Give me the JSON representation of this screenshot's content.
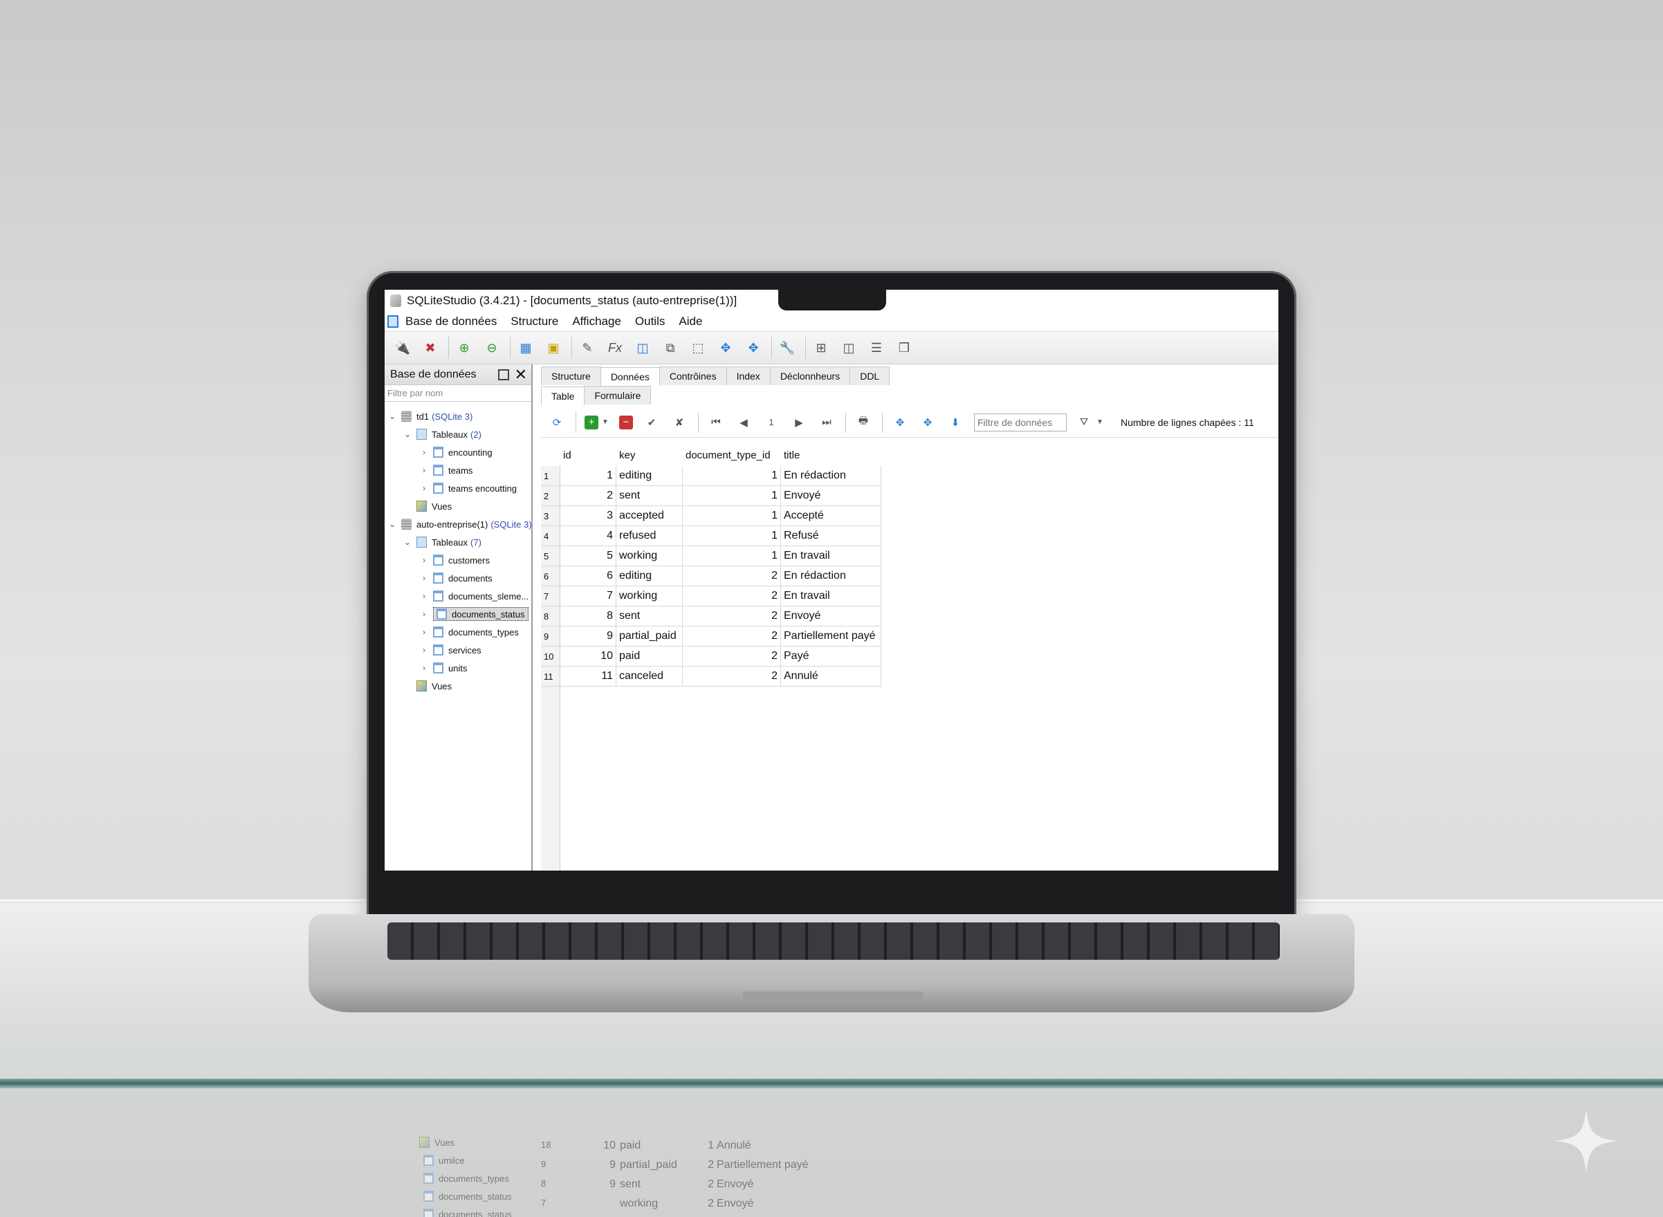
{
  "window": {
    "title": "SQLiteStudio (3.4.21) - [documents_status (auto-entreprise(1))]"
  },
  "menu": [
    "Base de données",
    "Structure",
    "Affichage",
    "Outils",
    "Aide"
  ],
  "left_panel": {
    "header": "Base de données",
    "filter_placeholder": "Filtre par nom",
    "tree": {
      "db1": {
        "name": "td1",
        "type": "(SQLite 3)"
      },
      "db1_tables": {
        "label": "Tableaux",
        "count": "(2)"
      },
      "db1_table_items": [
        "encounting",
        "teams",
        "teams encoutting"
      ],
      "db1_views": "Vues",
      "db2": {
        "name": "auto-entreprise(1)",
        "type": "(SQLite 3)"
      },
      "db2_tables": {
        "label": "Tableaux",
        "count": "(7)"
      },
      "db2_table_items": [
        "customers",
        "documents",
        "documents_sleme...",
        "documents_status",
        "documents_types",
        "services",
        "units"
      ],
      "db2_views": "Vues"
    }
  },
  "tabs": [
    "Structure",
    "Données",
    "Contrôines",
    "Index",
    "Déclonnheurs",
    "DDL"
  ],
  "subtabs": [
    "Table",
    "Formulaire"
  ],
  "data_toolbar": {
    "page": "1",
    "filter_placeholder": "Filtre de données",
    "row_count": "Numbre de lignes chapées : 11"
  },
  "grid": {
    "columns": [
      "id",
      "key",
      "document_type_id",
      "title"
    ],
    "rows": [
      [
        "1",
        "1",
        "editing",
        "1",
        "En rédaction"
      ],
      [
        "2",
        "2",
        "sent",
        "1",
        "Envoyé"
      ],
      [
        "3",
        "3",
        "accepted",
        "1",
        "Accepté"
      ],
      [
        "4",
        "4",
        "refused",
        "1",
        "Refusé"
      ],
      [
        "5",
        "5",
        "working",
        "1",
        "En travail"
      ],
      [
        "6",
        "6",
        "editing",
        "2",
        "En rédaction"
      ],
      [
        "7",
        "7",
        "working",
        "2",
        "En travail"
      ],
      [
        "8",
        "8",
        "sent",
        "2",
        "Envoyé"
      ],
      [
        "9",
        "9",
        "partial_paid",
        "2",
        "Partiellement payé"
      ],
      [
        "10",
        "10",
        "paid",
        "2",
        "Payé"
      ],
      [
        "11",
        "11",
        "canceled",
        "2",
        "Annulé"
      ]
    ]
  },
  "reflection": {
    "tree": [
      "Vues",
      "umilce",
      "documents_types",
      "documents_status",
      "documents_status"
    ],
    "rows": [
      [
        "18",
        "10",
        "paid",
        "1",
        "Annulé"
      ],
      [
        "9",
        "9",
        "partial_paid",
        "2",
        "Partiellement payé"
      ],
      [
        "8",
        "9",
        "sent",
        "2",
        "Envoyé"
      ],
      [
        "7",
        "",
        "working",
        "2",
        "Envoyé"
      ]
    ]
  },
  "icons": {
    "toolbar": [
      "connect-icon",
      "disconnect-icon",
      "add-db-icon",
      "remove-db-icon",
      "new-table-icon",
      "new-view-icon",
      "edit-icon",
      "function-icon",
      "collation-icon",
      "extension-icon",
      "package-icon",
      "tile-icon",
      "cascade-icon",
      "wrench-icon",
      "grid-icon",
      "split-icon",
      "rows-icon",
      "window-icon"
    ]
  }
}
